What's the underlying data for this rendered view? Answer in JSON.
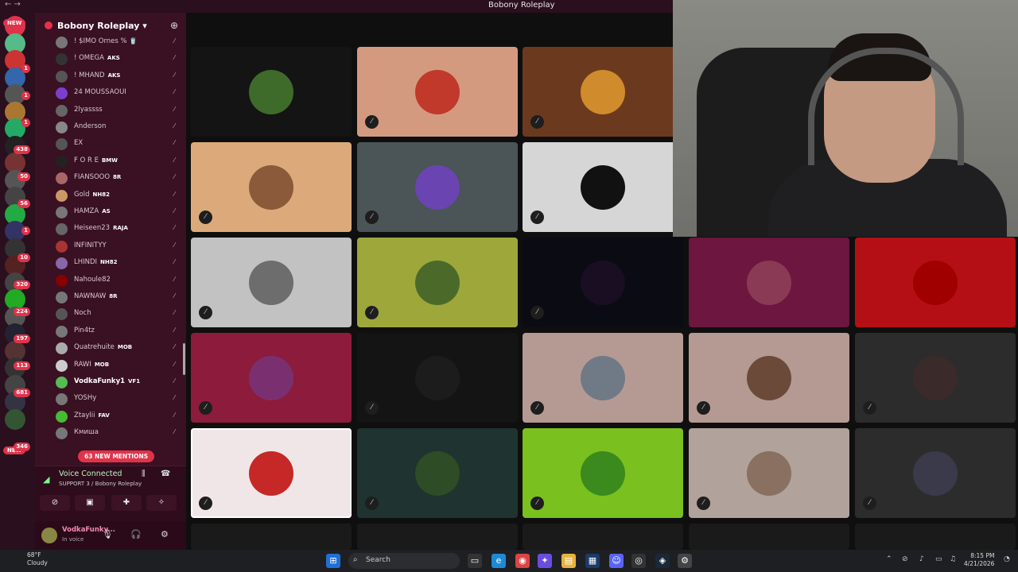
{
  "window": {
    "title": "Bobony Roleplay"
  },
  "server": {
    "name": "Bobony Roleplay"
  },
  "rail_badges": [
    "NEW",
    "1",
    "1",
    "1",
    "438",
    "50",
    "56",
    "1",
    "10",
    "320",
    "224",
    "197",
    "113",
    "681",
    "NEW",
    "346"
  ],
  "members": [
    {
      "name": "! $IMO Ornes % 🥤",
      "tag": ""
    },
    {
      "name": "! OMEGA",
      "tag": "AKS"
    },
    {
      "name": "! MHAND",
      "tag": "AKS"
    },
    {
      "name": "24 MOUSSAOUI",
      "tag": ""
    },
    {
      "name": "2lyassss",
      "tag": ""
    },
    {
      "name": "Anderson",
      "tag": ""
    },
    {
      "name": "EX",
      "tag": ""
    },
    {
      "name": "F O R E",
      "tag": "BMW"
    },
    {
      "name": "FIANSOOO",
      "tag": "8R"
    },
    {
      "name": "Gold",
      "tag": "NH82"
    },
    {
      "name": "HAMZA",
      "tag": "AS"
    },
    {
      "name": "Heiseen23",
      "tag": "RAJA"
    },
    {
      "name": "INFINITYY",
      "tag": ""
    },
    {
      "name": "LHINDI",
      "tag": "NH82"
    },
    {
      "name": "Nahoule82",
      "tag": ""
    },
    {
      "name": "NAWNAW",
      "tag": "8R"
    },
    {
      "name": "Noch",
      "tag": ""
    },
    {
      "name": "Pin4tz",
      "tag": ""
    },
    {
      "name": "Quatrehuite",
      "tag": "MOB"
    },
    {
      "name": "RAWI",
      "tag": "MOB"
    },
    {
      "name": "VodkaFunky1",
      "tag": "VF1"
    },
    {
      "name": "YOSHy",
      "tag": ""
    },
    {
      "name": "Ztaylii",
      "tag": "FAV"
    },
    {
      "name": "Кмиша",
      "tag": ""
    }
  ],
  "mentions": "63 NEW MENTIONS",
  "voice": {
    "status": "Voice Connected",
    "channel": "SUPPORT 3 / Bobony Roleplay"
  },
  "user": {
    "name": "VodkaFunky...",
    "status": "In voice"
  },
  "tiles": [
    {
      "bg": "#141414",
      "pic": "#3f6b2a"
    },
    {
      "bg": "#d49a80",
      "pic": "#c0392b"
    },
    {
      "bg": "#6b3a1e",
      "pic": "#d08b2c"
    },
    {
      "bg": "#dcaa7a",
      "pic": "#8a5a3a"
    },
    {
      "bg": "#4b5456",
      "pic": "#6a44b0"
    },
    {
      "bg": "#d6d6d6",
      "pic": "#111111"
    },
    {
      "bg": "#c2c2c2",
      "pic": "#6d6d6d"
    },
    {
      "bg": "#9ea73a",
      "pic": "#4b6a2a"
    },
    {
      "bg": "#0b0b14",
      "pic": "#1a0f22"
    },
    {
      "bg": "#6c1640",
      "pic": "#8b3a55"
    },
    {
      "bg": "#b50f16",
      "pic": "#a00000"
    },
    {
      "bg": "#8d1b3b",
      "pic": "#7a3070"
    },
    {
      "bg": "#141414",
      "pic": "#1c1c1c"
    },
    {
      "bg": "#b59a93",
      "pic": "#6f7a86"
    },
    {
      "bg": "#b59a93",
      "pic": "#6c4a3a"
    },
    {
      "bg": "#2c2c2c",
      "pic": "#3a2a2a"
    },
    {
      "bg": "#f1e6e7",
      "pic": "#c62828"
    },
    {
      "bg": "#1f3330",
      "pic": "#2e4c25"
    },
    {
      "bg": "#7ac01e",
      "pic": "#3a8a1e"
    },
    {
      "bg": "#b1a29b",
      "pic": "#8a7060"
    },
    {
      "bg": "#2c2c2c",
      "pic": "#3a3a4a"
    }
  ],
  "taskbar": {
    "temp": "68°F",
    "weather": "Cloudy",
    "search_placeholder": "Search",
    "time": "8:15 PM",
    "date": "4/21/2026"
  }
}
